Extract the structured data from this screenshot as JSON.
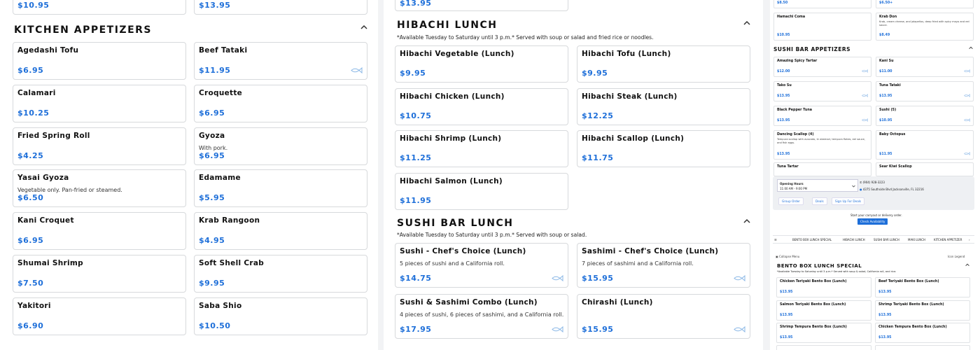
{
  "left": {
    "top_prices": [
      "$10.95",
      "$13.95"
    ],
    "section_title": "KITCHEN APPETIZERS",
    "items": [
      {
        "name": "Agedashi Tofu",
        "desc": "",
        "price": "$6.95",
        "fish": false
      },
      {
        "name": "Beef Tataki",
        "desc": "",
        "price": "$11.95",
        "fish": true
      },
      {
        "name": "Calamari",
        "desc": "",
        "price": "$10.25",
        "fish": false
      },
      {
        "name": "Croquette",
        "desc": "",
        "price": "$6.95",
        "fish": false
      },
      {
        "name": "Fried Spring Roll",
        "desc": "",
        "price": "$4.25",
        "fish": false
      },
      {
        "name": "Gyoza",
        "desc": "With pork.",
        "price": "$6.95",
        "fish": false
      },
      {
        "name": "Yasai Gyoza",
        "desc": "Vegetable only. Pan-fried or steamed.",
        "price": "$6.50",
        "fish": false
      },
      {
        "name": "Edamame",
        "desc": "",
        "price": "$5.95",
        "fish": false
      },
      {
        "name": "Kani Croquet",
        "desc": "",
        "price": "$6.95",
        "fish": false
      },
      {
        "name": "Krab Rangoon",
        "desc": "",
        "price": "$4.95",
        "fish": false
      },
      {
        "name": "Shumai Shrimp",
        "desc": "",
        "price": "$7.50",
        "fish": false
      },
      {
        "name": "Soft Shell Crab",
        "desc": "",
        "price": "$9.95",
        "fish": false
      },
      {
        "name": "Yakitori",
        "desc": "",
        "price": "$6.90",
        "fish": false
      },
      {
        "name": "Saba Shio",
        "desc": "",
        "price": "$10.50",
        "fish": false
      }
    ]
  },
  "middle": {
    "top_price": "$13.95",
    "hibachi": {
      "title": "HIBACHI LUNCH",
      "note": "*Available Tuesday to Saturday until 3 p.m.* Served with soup or salad and fried rice or noodles.",
      "items": [
        {
          "name": "Hibachi Vegetable (Lunch)",
          "desc": "",
          "price": "$9.95",
          "fish": false
        },
        {
          "name": "Hibachi Tofu (Lunch)",
          "desc": "",
          "price": "$9.95",
          "fish": false
        },
        {
          "name": "Hibachi Chicken (Lunch)",
          "desc": "",
          "price": "$10.75",
          "fish": false
        },
        {
          "name": "Hibachi Steak (Lunch)",
          "desc": "",
          "price": "$12.25",
          "fish": false
        },
        {
          "name": "Hibachi Shrimp (Lunch)",
          "desc": "",
          "price": "$11.25",
          "fish": false
        },
        {
          "name": "Hibachi Scallop (Lunch)",
          "desc": "",
          "price": "$11.75",
          "fish": false
        },
        {
          "name": "Hibachi Salmon (Lunch)",
          "desc": "",
          "price": "$11.95",
          "fish": false
        }
      ]
    },
    "sushi": {
      "title": "SUSHI BAR LUNCH",
      "note": "*Available Tuesday to Saturday until 3 p.m.* Served with soup or salad.",
      "items": [
        {
          "name": "Sushi - Chef's Choice (Lunch)",
          "desc": "5 pieces of sushi and a California roll.",
          "price": "$14.75",
          "fish": true
        },
        {
          "name": "Sashimi - Chef's Choice (Lunch)",
          "desc": "7 pieces of sashimi and a California roll.",
          "price": "$15.95",
          "fish": true
        },
        {
          "name": "Sushi & Sashimi Combo (Lunch)",
          "desc": "4 pieces of sushi, 6 pieces of sashimi, and a California roll.",
          "price": "$17.95",
          "fish": true
        },
        {
          "name": "Chirashi (Lunch)",
          "desc": "",
          "price": "$15.95",
          "fish": true
        }
      ]
    }
  },
  "right": {
    "top_items": [
      {
        "name": "",
        "desc": "",
        "price": "$8.50"
      },
      {
        "name": "",
        "desc": "",
        "price": "$6.50+"
      },
      {
        "name": "Hamachi Coma",
        "desc": "",
        "price": "$10.95"
      },
      {
        "name": "Krab Don",
        "desc": "Krab, cream cheese, and jalapeños, deep fried with spicy mayo and eel sauce.",
        "price": "$8.49"
      }
    ],
    "section_title": "SUSHI BAR APPETIZERS",
    "items": [
      {
        "name": "Amazing Spicy Tartar",
        "desc": "",
        "price": "$12.00"
      },
      {
        "name": "Kani Su",
        "desc": "",
        "price": "$11.00"
      },
      {
        "name": "Tako Su",
        "desc": "",
        "price": "$13.95"
      },
      {
        "name": "Tuna Tataki",
        "desc": "",
        "price": "$13.95"
      },
      {
        "name": "Black Pepper Tuna",
        "desc": "",
        "price": "$13.95"
      },
      {
        "name": "Sushi (5)",
        "desc": "",
        "price": "$10.95"
      },
      {
        "name": "Dancing Scallop (4)",
        "desc": "Tempura scallop with avocado, kr abstract, tempura flakes, eel sauce, and fish eggs.",
        "price": "$13.95"
      },
      {
        "name": "Baby Octopus",
        "desc": "",
        "price": "$11.95"
      }
    ],
    "partial_items": [
      "Tuna Tartar",
      "Sear Kiwi Scallop"
    ],
    "info": {
      "hours_label": "Opening Hours",
      "hours": "11:00 AM - 9:00 PM",
      "phone": "(904) 928-3223",
      "address": "4375 Southside Blvd Jacksonville, FL 32216",
      "buttons": [
        "Group Order",
        "Deals",
        "Sign Up For Deals"
      ],
      "prompt": "Start your carryout or delivery order.",
      "check": "Check Availability"
    },
    "nav_tabs": [
      "BENTO BOX LUNCH SPECIAL",
      "HIBACHI LUNCH",
      "SUSHI BAR LUNCH",
      "MAKI LUNCH",
      "KITCHEN APPETIZER"
    ],
    "bento": {
      "title": "BENTO BOX LUNCH SPECIAL",
      "note": "*Available Tuesday to Saturday until 3 p.m.* Served with soup & salad, California roll, and rice.",
      "items": [
        {
          "name": "Chicken Teriyaki Bento Box (Lunch)",
          "price": "$13.95"
        },
        {
          "name": "Beef Teriyaki Bento Box (Lunch)",
          "price": "$13.95"
        },
        {
          "name": "Salmon Teriyaki Bento Box (Lunch)",
          "price": "$13.95"
        },
        {
          "name": "Shrimp Teriyaki Bento Box (Lunch)",
          "price": "$13.95"
        },
        {
          "name": "Shrimp Tempura Bento Box (Lunch)",
          "price": "$13.95"
        },
        {
          "name": "Chicken Tempura Bento Box (Lunch)",
          "price": "$13.95"
        }
      ]
    }
  }
}
